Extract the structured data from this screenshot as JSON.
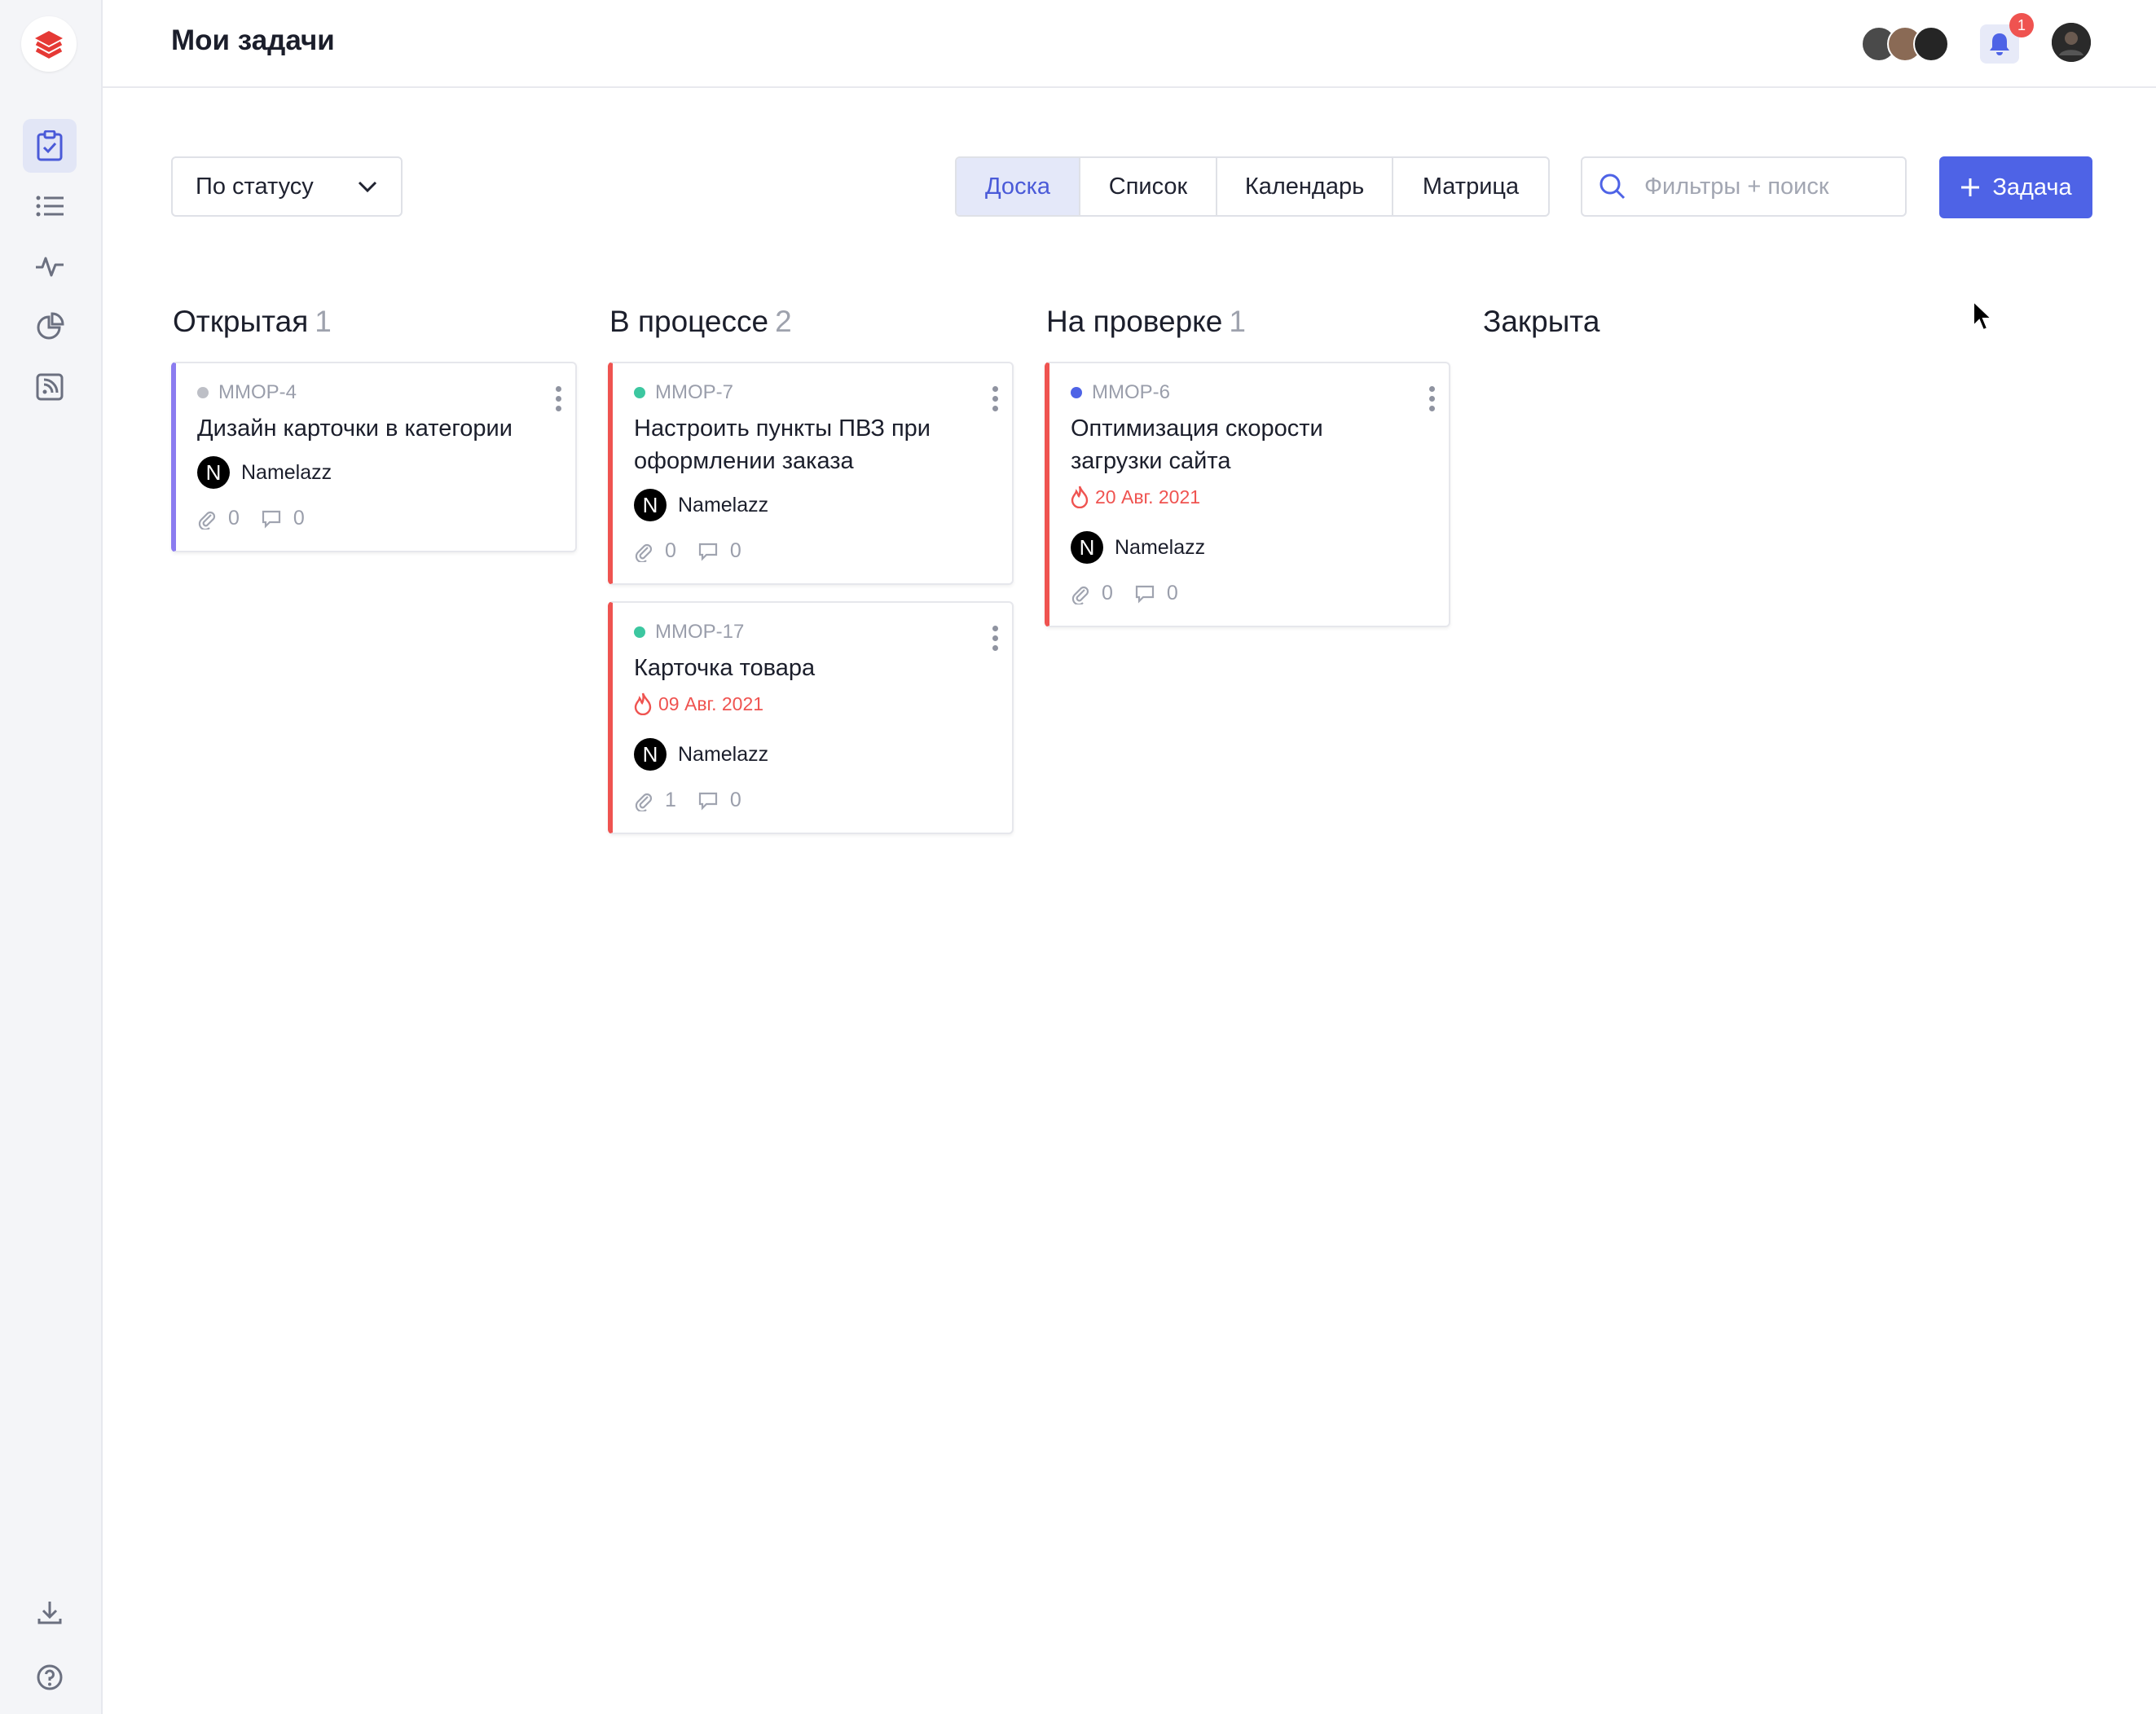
{
  "header": {
    "title": "Мои задачи",
    "notification_count": "1"
  },
  "toolbar": {
    "group_by": "По статусу",
    "views": [
      "Доска",
      "Список",
      "Календарь",
      "Матрица"
    ],
    "active_view": "Доска",
    "search_placeholder": "Фильтры + поиск",
    "add_label": "Задача"
  },
  "columns": [
    {
      "title": "Открытая",
      "count": "1"
    },
    {
      "title": "В процессе",
      "count": "2"
    },
    {
      "title": "На проверке",
      "count": "1"
    },
    {
      "title": "Закрыта",
      "count": ""
    }
  ],
  "cards": [
    {
      "key": "MMOP-4",
      "title": "Дизайн карточки в категории",
      "due": "",
      "assignee": "Namelazz",
      "assignee_initial": "N",
      "attachments": "0",
      "comments": "0",
      "status_color": "#bdbfc6",
      "accent": "#8b7cf0"
    },
    {
      "key": "MMOP-7",
      "title": "Настроить пункты ПВЗ при оформлении заказа",
      "due": "",
      "assignee": "Namelazz",
      "assignee_initial": "N",
      "attachments": "0",
      "comments": "0",
      "status_color": "#3cc7a0",
      "accent": "#ef5350"
    },
    {
      "key": "MMOP-17",
      "title": "Карточка товара",
      "due": "09 Авг. 2021",
      "assignee": "Namelazz",
      "assignee_initial": "N",
      "attachments": "1",
      "comments": "0",
      "status_color": "#3cc7a0",
      "accent": "#ef5350"
    },
    {
      "key": "MMOP-6",
      "title": "Оптимизация скорости загрузки сайта",
      "due": "20 Авг. 2021",
      "assignee": "Namelazz",
      "assignee_initial": "N",
      "attachments": "0",
      "comments": "0",
      "status_color": "#4e63e6",
      "accent": "#ef5350"
    }
  ],
  "colors": {
    "accent": "#4e63e6",
    "danger": "#ef5350"
  }
}
